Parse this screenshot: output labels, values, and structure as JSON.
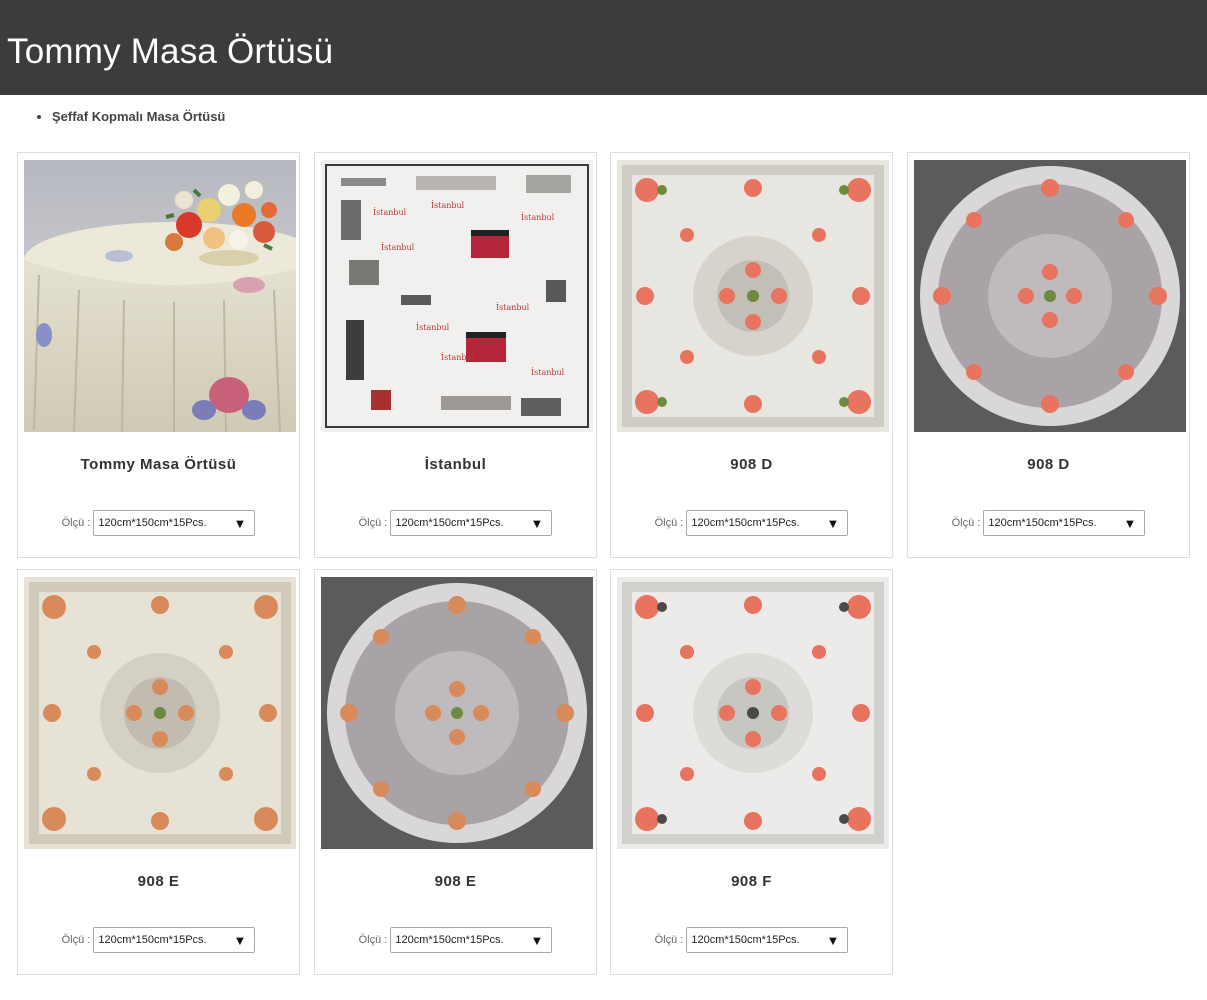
{
  "header": {
    "title": "Tommy Masa Örtüsü"
  },
  "breadcrumb": {
    "item": "Şeffaf Kopmalı Masa Örtüsü"
  },
  "size_label": "Ölçü :",
  "products": [
    {
      "name": "Tommy Masa Örtüsü",
      "size": "120cm*150cm*15Pcs.",
      "image": "round-table-with-bouquet"
    },
    {
      "name": "İstanbul",
      "size": "120cm*150cm*15Pcs.",
      "image": "istanbul-print-square"
    },
    {
      "name": "908 D",
      "size": "120cm*150cm*15Pcs.",
      "image": "floral-lace-square"
    },
    {
      "name": "908 D",
      "size": "120cm*150cm*15Pcs.",
      "image": "floral-lace-round"
    },
    {
      "name": "908 E",
      "size": "120cm*150cm*15Pcs.",
      "image": "floral-lace-square"
    },
    {
      "name": "908 E",
      "size": "120cm*150cm*15Pcs.",
      "image": "floral-lace-round"
    },
    {
      "name": "908 F",
      "size": "120cm*150cm*15Pcs.",
      "image": "floral-lace-square"
    }
  ],
  "colors": {
    "header_bg": "#3c3c3c",
    "card_border": "#dedede",
    "rose": "#e8735f"
  }
}
